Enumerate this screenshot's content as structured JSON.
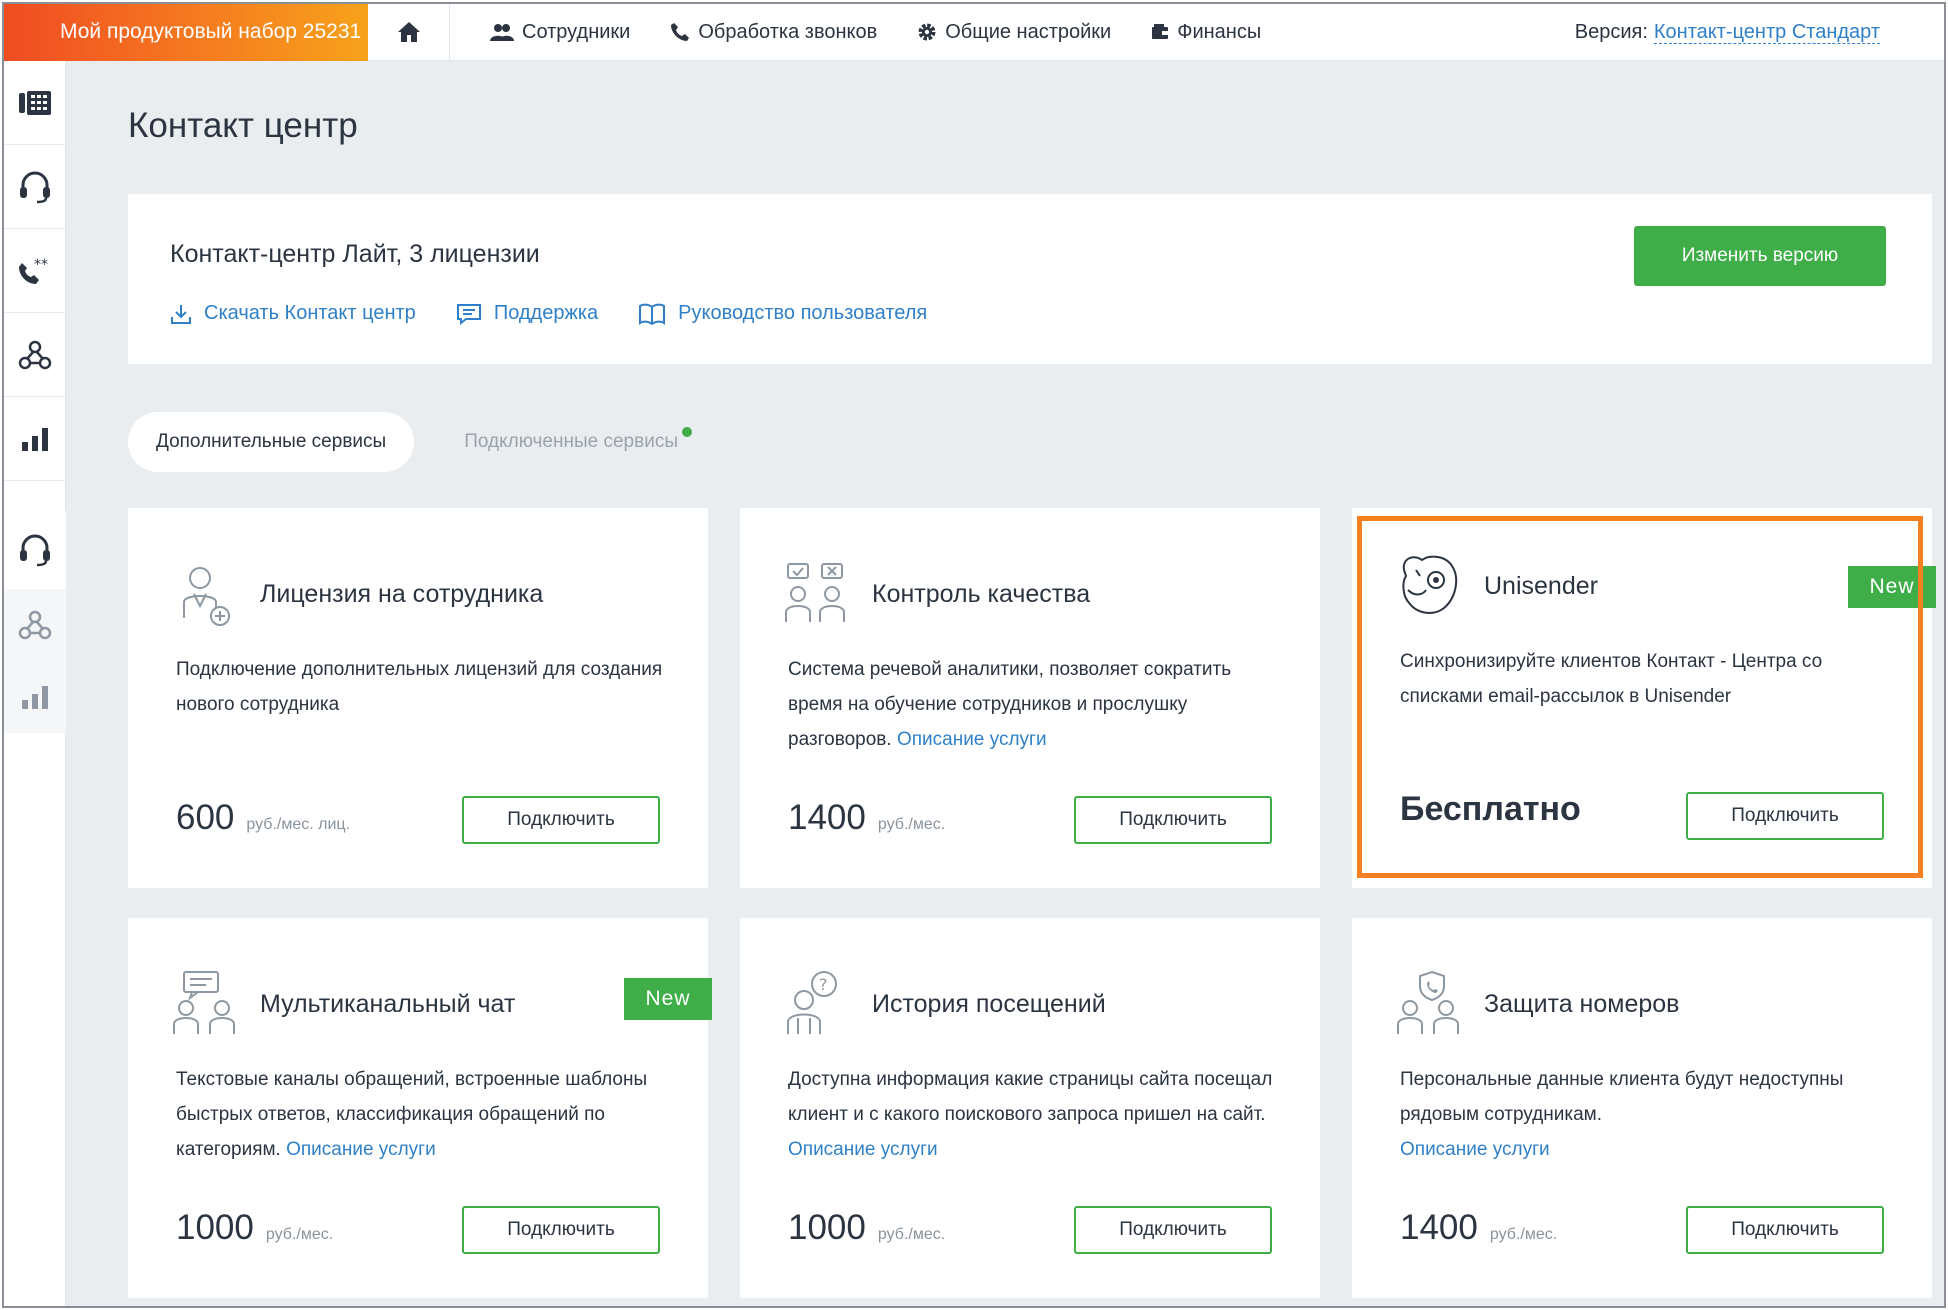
{
  "topbar": {
    "product": "Мой продуктовый набор 25231",
    "nav": [
      {
        "label": "Сотрудники",
        "icon": "users-icon"
      },
      {
        "label": "Обработка звонков",
        "icon": "phone-icon"
      },
      {
        "label": "Общие настройки",
        "icon": "gear-icon"
      },
      {
        "label": "Финансы",
        "icon": "wallet-icon"
      }
    ],
    "version_label": "Версия:",
    "version_value": "Контакт-центр Стандарт"
  },
  "sidebar": {
    "icons": [
      "call-center-icon",
      "headset-icon",
      "phone-stars-icon",
      "webhook-icon",
      "bar-chart-icon",
      "headset-icon",
      "webhook-icon",
      "bar-chart-icon"
    ]
  },
  "page": {
    "title": "Контакт центр"
  },
  "license": {
    "title": "Контакт-центр Лайт, 3 лицензии",
    "links": [
      {
        "label": "Скачать Контакт центр",
        "icon": "download-icon"
      },
      {
        "label": "Поддержка",
        "icon": "chat-icon"
      },
      {
        "label": "Руководство пользователя",
        "icon": "book-icon"
      }
    ],
    "change_button": "Изменить версию"
  },
  "tabs": {
    "active": "Дополнительные сервисы",
    "inactive": "Подключенные сервисы"
  },
  "colors": {
    "accent_green": "#3fae49",
    "link_blue": "#2f80c8",
    "highlight_orange": "#f5801f"
  },
  "services": [
    {
      "title": "Лицензия на сотрудника",
      "desc": "Подключение дополнительных лицензий для создания нового сотрудника",
      "more": "",
      "price": "600",
      "unit": "руб./мес. лиц.",
      "button": "Подключить",
      "badge": "",
      "icon": "user-add-icon"
    },
    {
      "title": "Контроль качества",
      "desc": "Система речевой аналитики, позволяет сократить время на обучение сотрудников и прослушку разговоров.",
      "more": "Описание услуги",
      "price": "1400",
      "unit": "руб./мес.",
      "button": "Подключить",
      "badge": "",
      "icon": "quality-control-icon"
    },
    {
      "title": "Unisender",
      "desc": "Синхронизируйте клиентов Контакт - Центра со списками email-рассылок в Unisender",
      "more": "",
      "price": "Бесплатно",
      "unit": "",
      "button": "Подключить",
      "badge": "New",
      "icon": "unisender-logo-icon"
    },
    {
      "title": "Мультиканальный чат",
      "desc": "Текстовые каналы обращений, встроенные шаблоны быстрых ответов, классификация обращений по категориям.",
      "more": "Описание услуги",
      "price": "1000",
      "unit": "руб./мес.",
      "button": "Подключить",
      "badge": "New",
      "icon": "multichannel-chat-icon"
    },
    {
      "title": "История посещений",
      "desc": "Доступна информация какие страницы сайта посещал клиент и с какого поискового запроса пришел на сайт.",
      "more": "Описание услуги",
      "price": "1000",
      "unit": "руб./мес.",
      "button": "Подключить",
      "badge": "",
      "icon": "visit-history-icon"
    },
    {
      "title": "Защита номеров",
      "desc": "Персональные данные клиента будут недоступны рядовым сотрудникам.",
      "more": "Описание услуги",
      "price": "1400",
      "unit": "руб./мес.",
      "button": "Подключить",
      "badge": "",
      "icon": "number-protection-icon"
    }
  ]
}
